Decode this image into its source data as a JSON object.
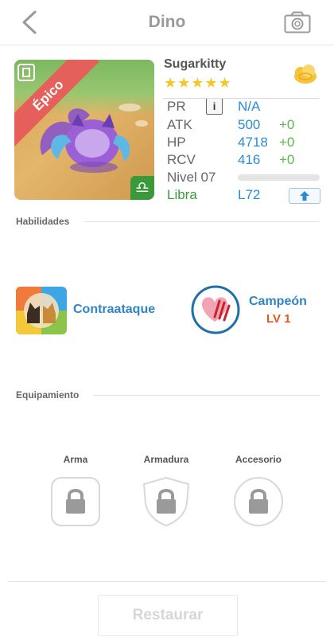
{
  "header": {
    "title": "Dino"
  },
  "monster": {
    "name": "Sugarkitty",
    "rarity": "Épico",
    "stars": "★★★★★",
    "star_count": 5,
    "zodiac_symbol": "♎",
    "stats": {
      "pr": {
        "label": "PR",
        "value": "N/A"
      },
      "atk": {
        "label": "ATK",
        "value": "500",
        "bonus": "+0"
      },
      "hp": {
        "label": "HP",
        "value": "4718",
        "bonus": "+0"
      },
      "rcv": {
        "label": "RCV",
        "value": "416",
        "bonus": "+0"
      }
    },
    "nivel_label": "Nivel 07",
    "xp_progress": 0,
    "sign_label": "Libra",
    "level_tag": "L72"
  },
  "skills_section": {
    "title": "Habilidades",
    "active_skill": {
      "name": "Contraataque"
    },
    "leader_skill": {
      "name": "Campeón",
      "level": "LV 1"
    }
  },
  "equipment_section": {
    "title": "Equipamiento",
    "slots": [
      {
        "label": "Arma",
        "locked": true
      },
      {
        "label": "Armadura",
        "locked": true
      },
      {
        "label": "Accesorio",
        "locked": true
      }
    ]
  },
  "footer": {
    "restore_label": "Restaurar"
  },
  "colors": {
    "accent_blue": "#2a8bd8",
    "bonus_green": "#58b84a",
    "rarity_red": "#e5605a",
    "star_gold": "#f7c52b",
    "level_orange": "#e8571f"
  },
  "icons": {
    "back": "chevron-left-icon",
    "camera": "camera-icon",
    "coin": "gold-cloud-icon",
    "info": "info-icon",
    "upgrade": "arrow-up-icon",
    "lock": "lock-icon"
  }
}
